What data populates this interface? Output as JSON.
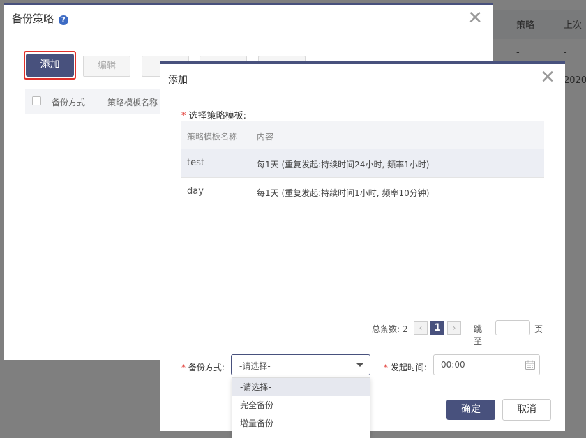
{
  "background": {
    "columns": [
      "策略",
      "上次"
    ],
    "row1": [
      "-",
      "-"
    ],
    "row2_tail": "2020"
  },
  "outer_dialog": {
    "title": "备份策略",
    "help_icon": "?",
    "toolbar": {
      "add_label": "添加",
      "edit_label": "编辑"
    },
    "table_headers": [
      "备份方式",
      "策略模板名称"
    ]
  },
  "inner_dialog": {
    "title": "添加",
    "section_label": "选择策略模板:",
    "template_table": {
      "headers": [
        "策略模板名称",
        "内容"
      ],
      "rows": [
        {
          "name": "test",
          "content": "每1天 (重复发起:持续时间24小时, 频率1小时)"
        },
        {
          "name": "day",
          "content": "每1天 (重复发起:持续时间1小时, 频率10分钟)"
        }
      ]
    },
    "pagination": {
      "total_text": "总条数: 2",
      "prev": "‹",
      "current": "1",
      "next": "›",
      "jump_label": "跳至",
      "page_unit": "页"
    },
    "form": {
      "backup_mode_label": "备份方式:",
      "backup_mode_value": "-请选择-",
      "start_time_label": "发起时间:",
      "start_time_value": "00:00"
    },
    "dropdown_options": [
      "-请选择-",
      "完全备份",
      "增量备份"
    ],
    "ok_label": "确定",
    "cancel_label": "取消"
  },
  "colors": {
    "primary": "#48517d",
    "highlight": "#e0302a"
  }
}
